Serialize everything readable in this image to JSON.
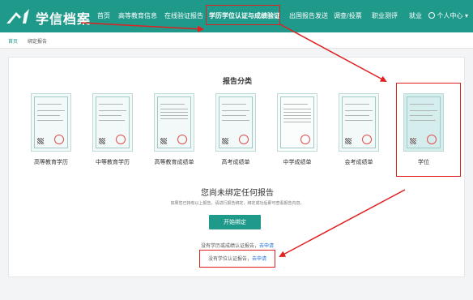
{
  "header": {
    "logo_text": "学信档案",
    "nav": [
      {
        "label": "首页"
      },
      {
        "label": "高等教育信息"
      },
      {
        "label": "在线验证报告"
      },
      {
        "label": "学历学位认证与成绩验证"
      },
      {
        "label": "出国报告发送"
      },
      {
        "label": "调查/投票"
      },
      {
        "label": "职业测评"
      },
      {
        "label": "就业"
      }
    ],
    "user_label": "个人中心",
    "user_caret": "▾"
  },
  "breadcrumb": {
    "home": "首页",
    "current": "绑定报告"
  },
  "main": {
    "section_title": "报告分类",
    "categories": [
      {
        "label": "高等教育学历"
      },
      {
        "label": "中等教育学历"
      },
      {
        "label": "高等教育成绩单"
      },
      {
        "label": "高考成绩单"
      },
      {
        "label": "中学成绩单"
      },
      {
        "label": "会考成绩单"
      },
      {
        "label": "学位"
      }
    ],
    "empty_title": "您尚未绑定任何报告",
    "empty_desc": "如果您已持有以上报告，请进行报告绑定，绑定成功后即可查看报告内容。",
    "bind_button": "开始绑定",
    "apply_text_1": "没有学历或成绩认证报告，",
    "apply_link_1": "去申请",
    "apply_text_2": "没有学位认证报告，",
    "apply_link_2": "去申请"
  },
  "colors": {
    "brand": "#1f9a8a",
    "annotation": "#e02020",
    "link": "#1f6fd8"
  }
}
